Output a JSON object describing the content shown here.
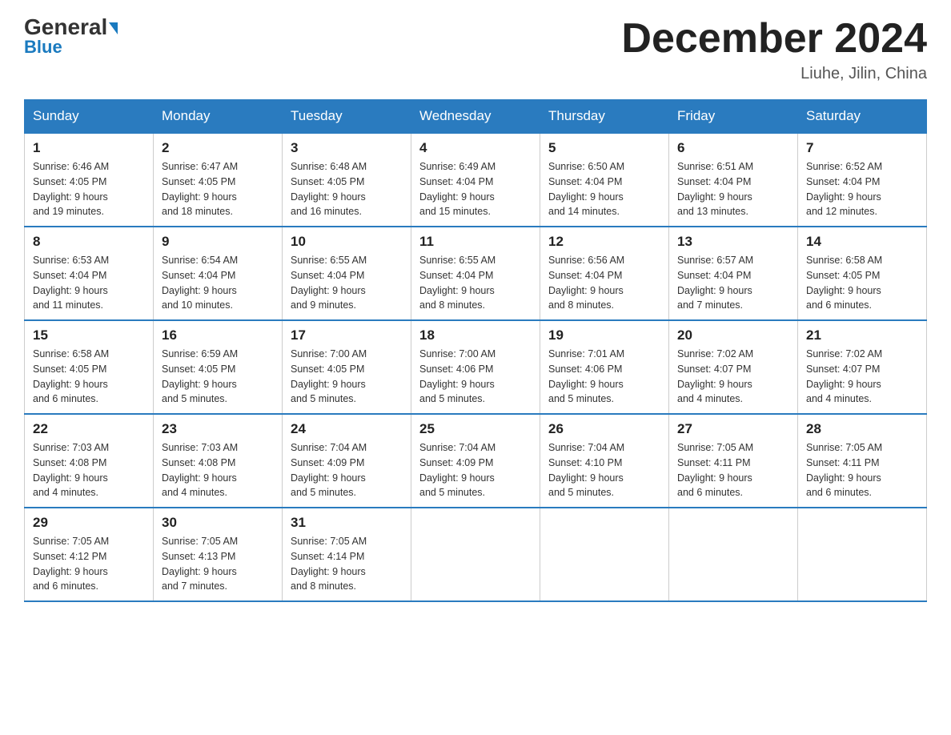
{
  "header": {
    "logo_general": "General",
    "logo_blue": "Blue",
    "month_title": "December 2024",
    "location": "Liuhe, Jilin, China"
  },
  "days_of_week": [
    "Sunday",
    "Monday",
    "Tuesday",
    "Wednesday",
    "Thursday",
    "Friday",
    "Saturday"
  ],
  "weeks": [
    [
      {
        "day": "1",
        "sunrise": "6:46 AM",
        "sunset": "4:05 PM",
        "daylight": "9 hours and 19 minutes."
      },
      {
        "day": "2",
        "sunrise": "6:47 AM",
        "sunset": "4:05 PM",
        "daylight": "9 hours and 18 minutes."
      },
      {
        "day": "3",
        "sunrise": "6:48 AM",
        "sunset": "4:05 PM",
        "daylight": "9 hours and 16 minutes."
      },
      {
        "day": "4",
        "sunrise": "6:49 AM",
        "sunset": "4:04 PM",
        "daylight": "9 hours and 15 minutes."
      },
      {
        "day": "5",
        "sunrise": "6:50 AM",
        "sunset": "4:04 PM",
        "daylight": "9 hours and 14 minutes."
      },
      {
        "day": "6",
        "sunrise": "6:51 AM",
        "sunset": "4:04 PM",
        "daylight": "9 hours and 13 minutes."
      },
      {
        "day": "7",
        "sunrise": "6:52 AM",
        "sunset": "4:04 PM",
        "daylight": "9 hours and 12 minutes."
      }
    ],
    [
      {
        "day": "8",
        "sunrise": "6:53 AM",
        "sunset": "4:04 PM",
        "daylight": "9 hours and 11 minutes."
      },
      {
        "day": "9",
        "sunrise": "6:54 AM",
        "sunset": "4:04 PM",
        "daylight": "9 hours and 10 minutes."
      },
      {
        "day": "10",
        "sunrise": "6:55 AM",
        "sunset": "4:04 PM",
        "daylight": "9 hours and 9 minutes."
      },
      {
        "day": "11",
        "sunrise": "6:55 AM",
        "sunset": "4:04 PM",
        "daylight": "9 hours and 8 minutes."
      },
      {
        "day": "12",
        "sunrise": "6:56 AM",
        "sunset": "4:04 PM",
        "daylight": "9 hours and 8 minutes."
      },
      {
        "day": "13",
        "sunrise": "6:57 AM",
        "sunset": "4:04 PM",
        "daylight": "9 hours and 7 minutes."
      },
      {
        "day": "14",
        "sunrise": "6:58 AM",
        "sunset": "4:05 PM",
        "daylight": "9 hours and 6 minutes."
      }
    ],
    [
      {
        "day": "15",
        "sunrise": "6:58 AM",
        "sunset": "4:05 PM",
        "daylight": "9 hours and 6 minutes."
      },
      {
        "day": "16",
        "sunrise": "6:59 AM",
        "sunset": "4:05 PM",
        "daylight": "9 hours and 5 minutes."
      },
      {
        "day": "17",
        "sunrise": "7:00 AM",
        "sunset": "4:05 PM",
        "daylight": "9 hours and 5 minutes."
      },
      {
        "day": "18",
        "sunrise": "7:00 AM",
        "sunset": "4:06 PM",
        "daylight": "9 hours and 5 minutes."
      },
      {
        "day": "19",
        "sunrise": "7:01 AM",
        "sunset": "4:06 PM",
        "daylight": "9 hours and 5 minutes."
      },
      {
        "day": "20",
        "sunrise": "7:02 AM",
        "sunset": "4:07 PM",
        "daylight": "9 hours and 4 minutes."
      },
      {
        "day": "21",
        "sunrise": "7:02 AM",
        "sunset": "4:07 PM",
        "daylight": "9 hours and 4 minutes."
      }
    ],
    [
      {
        "day": "22",
        "sunrise": "7:03 AM",
        "sunset": "4:08 PM",
        "daylight": "9 hours and 4 minutes."
      },
      {
        "day": "23",
        "sunrise": "7:03 AM",
        "sunset": "4:08 PM",
        "daylight": "9 hours and 4 minutes."
      },
      {
        "day": "24",
        "sunrise": "7:04 AM",
        "sunset": "4:09 PM",
        "daylight": "9 hours and 5 minutes."
      },
      {
        "day": "25",
        "sunrise": "7:04 AM",
        "sunset": "4:09 PM",
        "daylight": "9 hours and 5 minutes."
      },
      {
        "day": "26",
        "sunrise": "7:04 AM",
        "sunset": "4:10 PM",
        "daylight": "9 hours and 5 minutes."
      },
      {
        "day": "27",
        "sunrise": "7:05 AM",
        "sunset": "4:11 PM",
        "daylight": "9 hours and 6 minutes."
      },
      {
        "day": "28",
        "sunrise": "7:05 AM",
        "sunset": "4:11 PM",
        "daylight": "9 hours and 6 minutes."
      }
    ],
    [
      {
        "day": "29",
        "sunrise": "7:05 AM",
        "sunset": "4:12 PM",
        "daylight": "9 hours and 6 minutes."
      },
      {
        "day": "30",
        "sunrise": "7:05 AM",
        "sunset": "4:13 PM",
        "daylight": "9 hours and 7 minutes."
      },
      {
        "day": "31",
        "sunrise": "7:05 AM",
        "sunset": "4:14 PM",
        "daylight": "9 hours and 8 minutes."
      },
      null,
      null,
      null,
      null
    ]
  ],
  "labels": {
    "sunrise": "Sunrise:",
    "sunset": "Sunset:",
    "daylight": "Daylight:"
  }
}
